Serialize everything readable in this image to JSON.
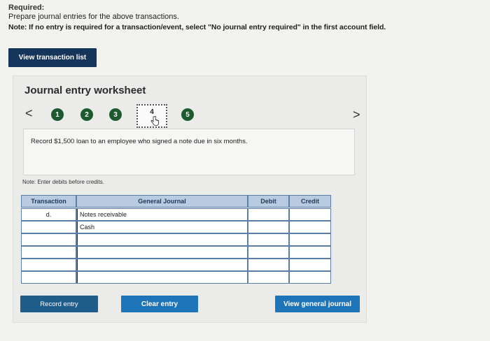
{
  "required": {
    "title": "Required:",
    "instruction": "Prepare journal entries for the above transactions.",
    "note": "Note: If no entry is required for a transaction/event, select \"No journal entry required\" in the first account field."
  },
  "buttons": {
    "view_transaction_list": "View transaction list",
    "record_entry": "Record entry",
    "clear_entry": "Clear entry",
    "view_general_journal": "View general journal"
  },
  "worksheet": {
    "title": "Journal entry worksheet",
    "prev_arrow": "<",
    "next_arrow": ">",
    "steps": [
      "1",
      "2",
      "3",
      "4",
      "5"
    ],
    "current_step": "4",
    "description": "Record $1,500 loan to an employee who signed a note due in six months.",
    "entry_note": "Note: Enter debits before credits."
  },
  "journal": {
    "headers": {
      "transaction": "Transaction",
      "general_journal": "General Journal",
      "debit": "Debit",
      "credit": "Credit"
    },
    "rows": [
      {
        "transaction": "d.",
        "account": "Notes receivable",
        "debit": "",
        "credit": ""
      },
      {
        "transaction": "",
        "account": "Cash",
        "debit": "",
        "credit": ""
      },
      {
        "transaction": "",
        "account": "",
        "debit": "",
        "credit": ""
      },
      {
        "transaction": "",
        "account": "",
        "debit": "",
        "credit": ""
      },
      {
        "transaction": "",
        "account": "",
        "debit": "",
        "credit": ""
      },
      {
        "transaction": "",
        "account": "",
        "debit": "",
        "credit": ""
      }
    ]
  },
  "icons": {
    "step_current_cursor": "hand-pointer-icon"
  },
  "colors": {
    "dark_navy_button": "#16355a",
    "step_green": "#1d5a2f",
    "table_header": "#b9cbe0",
    "blue_button": "#1e74b8"
  }
}
